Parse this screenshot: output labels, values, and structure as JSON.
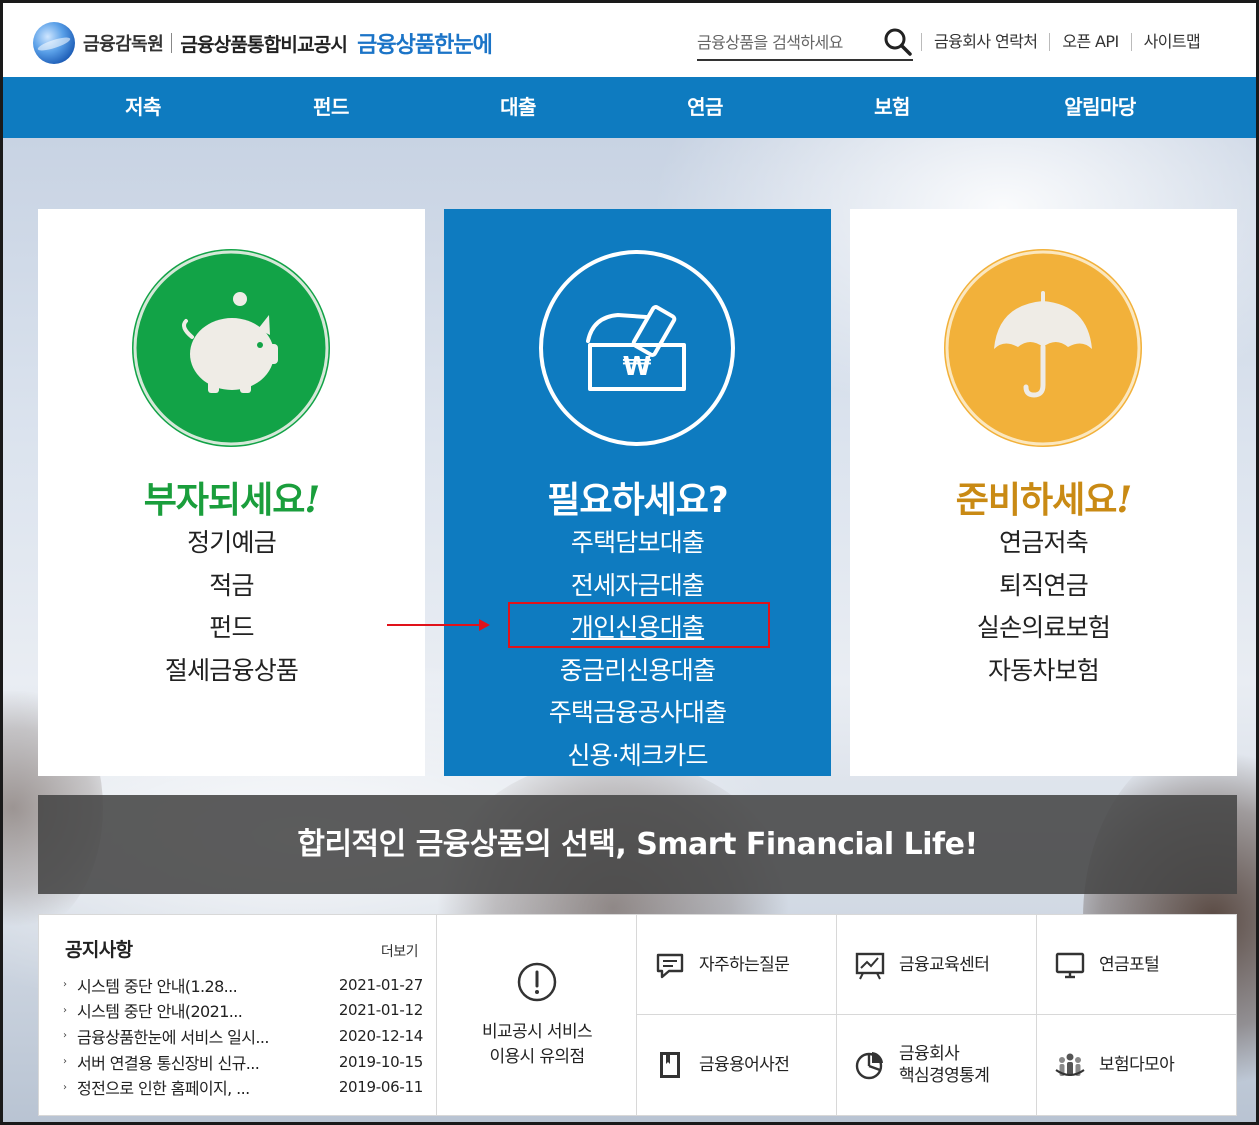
{
  "header": {
    "org_name": "금융감독원",
    "site_desc": "금융상품통합비교공시",
    "brand": "금융상품한눈에",
    "search_placeholder": "금융상품을 검색하세요",
    "links": [
      "금융회사 연락처",
      "오픈 API",
      "사이트맵"
    ]
  },
  "nav": {
    "items": [
      "저축",
      "펀드",
      "대출",
      "연금",
      "보험",
      "알림마당"
    ]
  },
  "cards": [
    {
      "title": "부자되세요",
      "title_mark": "!",
      "title_color": "#1a9e3c",
      "circle_color": "#12a347",
      "icon": "piggy-bank-icon",
      "items": [
        "정기예금",
        "적금",
        "펀드",
        "절세금융상품"
      ]
    },
    {
      "title": "필요하세요?",
      "title_color": "#ffffff",
      "circle_color": "#0e7bc0",
      "icon": "won-wallet-icon",
      "items": [
        "주택담보대출",
        "전세자금대출",
        "개인신용대출",
        "중금리신용대출",
        "주택금융공사대출",
        "신용·체크카드"
      ],
      "highlighted_item": "개인신용대출"
    },
    {
      "title": "준비하세요",
      "title_mark": "!",
      "title_color": "#c98a14",
      "circle_color": "#f2b13a",
      "icon": "umbrella-icon",
      "items": [
        "연금저축",
        "퇴직연금",
        "실손의료보험",
        "자동차보험"
      ]
    }
  ],
  "slogan": "합리적인 금융상품의 선택, Smart Financial Life!",
  "notice": {
    "title": "공지사항",
    "more": "더보기",
    "items": [
      {
        "title": "시스템 중단 안내(1.28...",
        "date": "2021-01-27"
      },
      {
        "title": "시스템 중단 안내(2021...",
        "date": "2021-01-12"
      },
      {
        "title": "금융상품한눈에 서비스 일시...",
        "date": "2020-12-14"
      },
      {
        "title": "서버 연결용 통신장비 신규...",
        "date": "2019-10-15"
      },
      {
        "title": "정전으로 인한 홈페이지, ...",
        "date": "2019-06-11"
      }
    ]
  },
  "caution": {
    "line1": "비교공시 서비스",
    "line2": "이용시 유의점",
    "icon": "exclamation-circle-icon"
  },
  "tiles": [
    {
      "label": "자주하는질문",
      "icon": "faq-chat-icon"
    },
    {
      "label": "금융교육센터",
      "icon": "chart-board-icon"
    },
    {
      "label": "연금포털",
      "icon": "monitor-icon"
    },
    {
      "label": "금융용어사전",
      "icon": "book-icon"
    },
    {
      "label_line1": "금융회사",
      "label_line2": "핵심경영통계",
      "icon": "pie-chart-icon"
    },
    {
      "label": "보험다모아",
      "icon": "people-group-icon"
    }
  ],
  "colors": {
    "primary_blue": "#0e7bc0",
    "highlight_red": "#e0121a",
    "green": "#12a347",
    "orange": "#f2b13a"
  }
}
